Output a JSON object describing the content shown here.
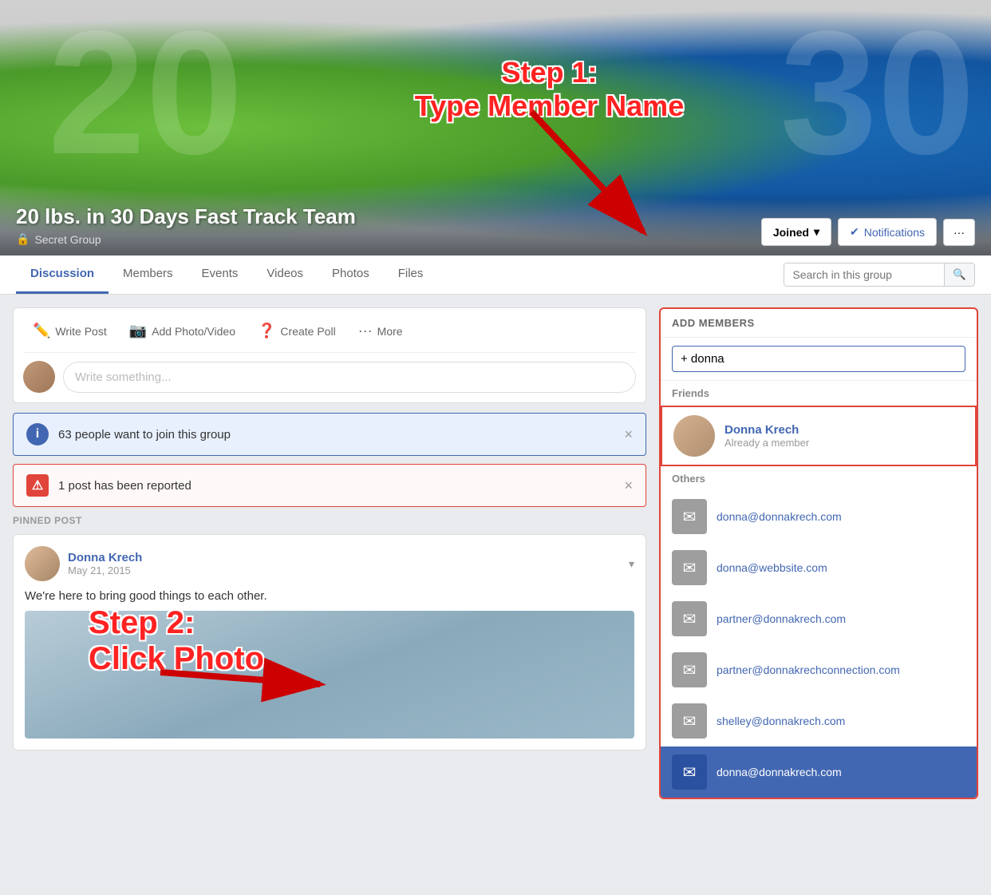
{
  "cover": {
    "group_name": "20 lbs. in 30 Days Fast Track Team",
    "group_type": "Secret Group",
    "num_left": "20",
    "num_right": "30",
    "step1_line1": "Step 1:",
    "step1_line2": "Type Member Name"
  },
  "actions": {
    "joined_label": "Joined",
    "notifications_label": "Notifications",
    "more_dots": "···",
    "search_placeholder": "Search in this group"
  },
  "nav": {
    "tabs": [
      {
        "label": "Discussion",
        "active": true
      },
      {
        "label": "Members",
        "active": false
      },
      {
        "label": "Events",
        "active": false
      },
      {
        "label": "Videos",
        "active": false
      },
      {
        "label": "Photos",
        "active": false
      },
      {
        "label": "Files",
        "active": false
      }
    ]
  },
  "post_bar": {
    "write_post": "Write Post",
    "add_photo": "Add Photo/Video",
    "create_poll": "Create Poll",
    "more": "More",
    "write_placeholder": "Write something..."
  },
  "alerts": {
    "join_text": "63 people want to join this group",
    "report_text": "1 post has been reported"
  },
  "pinned_post": {
    "label": "PINNED POST",
    "author": "Donna Krech",
    "date": "May 21, 2015",
    "text": "We're here to bring good things to each other."
  },
  "step2": {
    "line1": "Step 2:",
    "line2": "Click Photo"
  },
  "add_members": {
    "header": "ADD MEMBERS",
    "input_prefix": "+",
    "input_value": "donna",
    "friends_label": "Friends",
    "friend_name": "Donna Krech",
    "friend_status": "Already a member",
    "others_label": "Others",
    "emails": [
      "donna@donnakrech.com",
      "donna@webbsite.com",
      "partner@donnakrech.com",
      "partner@donnakrechconnection.com",
      "shelley@donnakrech.com",
      "donna@donnakrech.com"
    ]
  }
}
